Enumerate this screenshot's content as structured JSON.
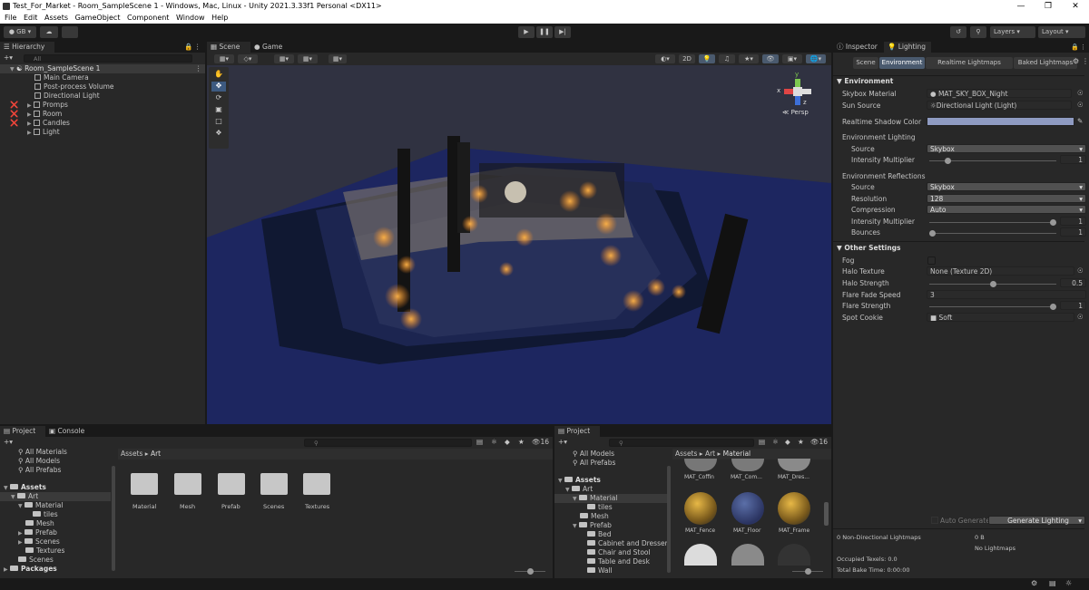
{
  "window": {
    "title": "Test_For_Market - Room_SampleScene 1 - Windows, Mac, Linux - Unity 2021.3.33f1 Personal <DX11>"
  },
  "menu": [
    "File",
    "Edit",
    "Assets",
    "GameObject",
    "Component",
    "Window",
    "Help"
  ],
  "toolbar": {
    "account": "GB",
    "layers": "Layers",
    "layout": "Layout"
  },
  "hierarchy": {
    "tab": "Hierarchy",
    "search": "All",
    "scene": "Room_SampleScene 1",
    "items": [
      "Main Camera",
      "Post-process Volume",
      "Directional Light",
      "Promps",
      "Room",
      "Candles",
      "Light"
    ]
  },
  "scene": {
    "tabs": [
      "Scene",
      "Game"
    ],
    "btn2d": "2D",
    "persp": "Persp",
    "axes": {
      "x": "x",
      "y": "y",
      "z": "z"
    }
  },
  "inspector": {
    "tabs": [
      "Inspector",
      "Lighting"
    ],
    "subtabs": [
      "Scene",
      "Environment",
      "Realtime Lightmaps",
      "Baked Lightmaps"
    ],
    "environment": "Environment",
    "skybox_material": {
      "label": "Skybox Material",
      "value": "MAT_SKY_BOX_Night"
    },
    "sun_source": {
      "label": "Sun Source",
      "value": "Directional Light (Light)"
    },
    "shadow_color": {
      "label": "Realtime Shadow Color",
      "color": "#8f9bc2"
    },
    "env_lighting": "Environment Lighting",
    "el_source": {
      "label": "Source",
      "value": "Skybox"
    },
    "el_intensity": {
      "label": "Intensity Multiplier",
      "value": "1",
      "fraction": 0.125
    },
    "env_reflections": "Environment Reflections",
    "er_source": {
      "label": "Source",
      "value": "Skybox"
    },
    "er_resolution": {
      "label": "Resolution",
      "value": "128"
    },
    "er_compression": {
      "label": "Compression",
      "value": "Auto"
    },
    "er_intensity": {
      "label": "Intensity Multiplier",
      "value": "1",
      "fraction": 1.0
    },
    "er_bounces": {
      "label": "Bounces",
      "value": "1",
      "fraction": 0.0
    },
    "other": "Other Settings",
    "fog": {
      "label": "Fog"
    },
    "halo_texture": {
      "label": "Halo Texture",
      "value": "None (Texture 2D)"
    },
    "halo_strength": {
      "label": "Halo Strength",
      "value": "0.5",
      "fraction": 0.5
    },
    "flare_fade": {
      "label": "Flare Fade Speed",
      "value": "3"
    },
    "flare_strength": {
      "label": "Flare Strength",
      "value": "1",
      "fraction": 1.0
    },
    "spot_cookie": {
      "label": "Spot Cookie",
      "value": "Soft"
    },
    "auto_generate": "Auto Generate",
    "generate": "Generate Lighting",
    "stats": {
      "non_dir": "0 Non-Directional Lightmaps",
      "size": "0 B",
      "no_lightmaps": "No Lightmaps",
      "occupied": "Occupied Texels: 0.0",
      "bake_time": "Total Bake Time: 0:00:00"
    }
  },
  "project1": {
    "tabs": [
      "Project",
      "Console"
    ],
    "favorites": [
      "All Materials",
      "All Models",
      "All Prefabs"
    ],
    "assets": "Assets",
    "tree": [
      "Art",
      "Material",
      "tiles",
      "Mesh",
      "Prefab",
      "Scenes",
      "Textures",
      "Scenes"
    ],
    "packages": "Packages",
    "breadcrumb": [
      "Assets",
      "Art"
    ],
    "count": "16",
    "folders": [
      "Material",
      "Mesh",
      "Prefab",
      "Scenes",
      "Textures"
    ]
  },
  "project2": {
    "tab": "Project",
    "favorites": [
      "All Models",
      "All Prefabs"
    ],
    "assets": "Assets",
    "tree": [
      "Art",
      "Material",
      "tiles",
      "Mesh",
      "Prefab",
      "Bed",
      "Cabinet and Dresser",
      "Chair and Stool",
      "Table and Desk",
      "Wall"
    ],
    "breadcrumb": [
      "Assets",
      "Art",
      "Material"
    ],
    "count": "16",
    "mats_top": [
      "MAT_Coffin",
      "MAT_Com...",
      "MAT_Dres..."
    ],
    "mats_mid": [
      "MAT_Fence",
      "MAT_Floor",
      "MAT_Frame"
    ]
  }
}
